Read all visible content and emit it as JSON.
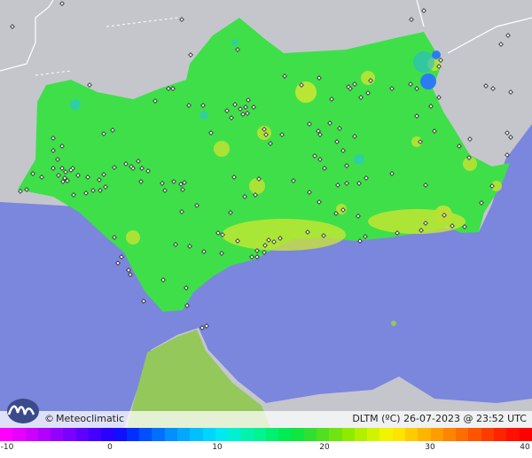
{
  "brand": {
    "copyright_symbol": "©",
    "name": "Meteoclimatic"
  },
  "map_info": {
    "variable": "DLTM (ºC)",
    "timestamp": "26-07-2023 @ 23:52 UTC"
  },
  "scale": {
    "ticks": [
      "-10",
      "0",
      "10",
      "20",
      "30",
      "40"
    ],
    "colors": [
      "#ff00ff",
      "#e600ff",
      "#cc00ff",
      "#b000ff",
      "#9400ff",
      "#7a00ff",
      "#5f00ff",
      "#4400ff",
      "#2a00ff",
      "#1010ff",
      "#0030ff",
      "#0050ff",
      "#0070ff",
      "#0090ff",
      "#00a8ff",
      "#00c0ff",
      "#00d4ff",
      "#00e8f0",
      "#00f0d0",
      "#00f4b0",
      "#00f490",
      "#00f070",
      "#00ec50",
      "#10e640",
      "#30e030",
      "#50e020",
      "#70e410",
      "#90ea00",
      "#b0f000",
      "#d0f400",
      "#f0f400",
      "#ffe400",
      "#ffcc00",
      "#ffb400",
      "#ff9c00",
      "#ff8400",
      "#ff6c00",
      "#ff5400",
      "#ff3c00",
      "#ff2400",
      "#ff1000",
      "#ff0000"
    ]
  },
  "colors": {
    "sea": "#7b86dd",
    "land_outside": "#c4c6cc",
    "region": "#3fdf4a",
    "africa": "#94c85a"
  }
}
